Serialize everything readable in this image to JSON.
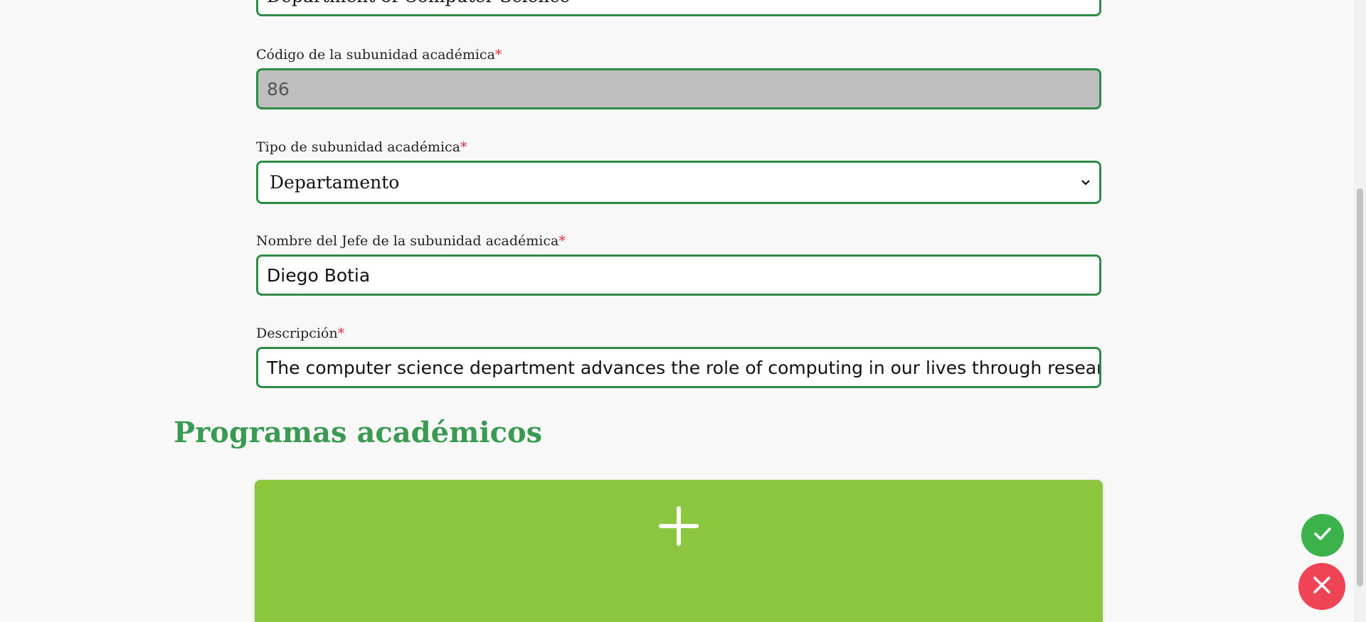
{
  "form": {
    "name_field": {
      "value": "Department of Computer Science"
    },
    "code_field": {
      "label": "Código de la subunidad académica",
      "required_mark": "*",
      "value": "86"
    },
    "type_field": {
      "label": "Tipo de subunidad académica",
      "required_mark": "*",
      "selected": "Departamento",
      "caret": "⌄"
    },
    "head_field": {
      "label": "Nombre del Jefe de la subunidad académica",
      "required_mark": "*",
      "value": "Diego Botia"
    },
    "description_field": {
      "label": "Descripción",
      "required_mark": "*",
      "value": "The computer science department advances the role of computing in our lives through research an"
    }
  },
  "programs": {
    "title": "Programas académicos",
    "add_icon": "plus-icon"
  },
  "actions": {
    "confirm_icon": "check-icon",
    "cancel_icon": "close-icon",
    "confirm_color": "#3bb34a",
    "cancel_color": "#ef4455"
  },
  "colors": {
    "accent_green": "#2e8c47",
    "title_green": "#3a9a52",
    "add_card_green": "#8cc63f",
    "required_red": "#e0263c"
  }
}
